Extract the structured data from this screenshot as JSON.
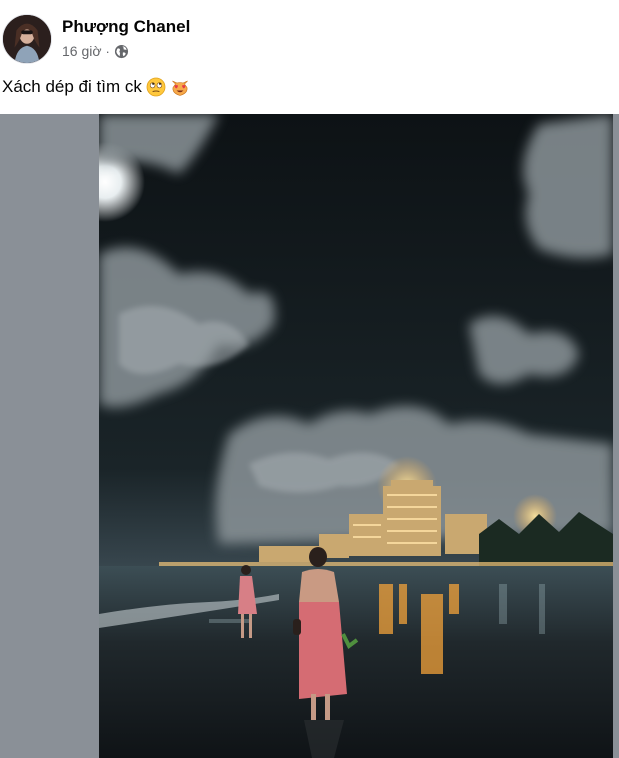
{
  "post": {
    "author": "Phượng Chanel",
    "time": "16 giờ",
    "separator": "·",
    "privacy_icon": "globe-icon",
    "text": "Xách dép đi tìm ck",
    "emojis": [
      "eye-roll-emoji",
      "heart-eyes-cat-emoji"
    ]
  },
  "media": {
    "type": "photo",
    "description_icon": "night-beach-photo",
    "colors": {
      "sky": "#0f1417",
      "cloud": "#6f777c",
      "sea": "#1d2226",
      "city_lights": "#f2a23a",
      "side_panel": "#8a9097"
    }
  }
}
